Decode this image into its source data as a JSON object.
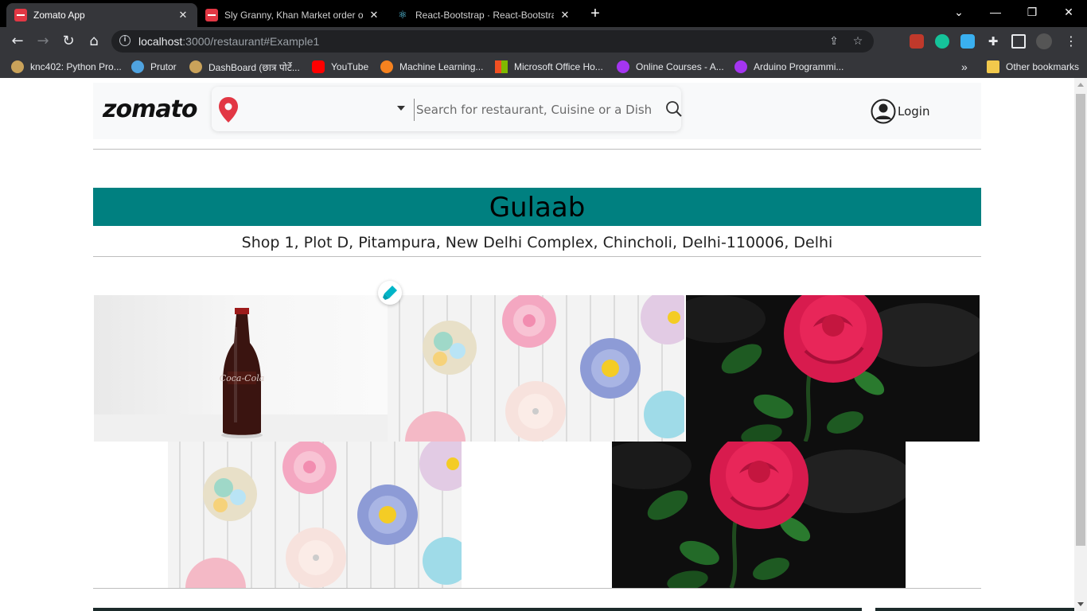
{
  "browser": {
    "tabs": [
      {
        "title": "Zomato App",
        "active": true,
        "favicon": "zomato-icon"
      },
      {
        "title": "Sly Granny, Khan Market order o",
        "active": false,
        "favicon": "zomato-icon"
      },
      {
        "title": "React-Bootstrap · React-Bootstrap",
        "active": false,
        "favicon": "react-icon"
      }
    ],
    "new_tab": "+",
    "window_controls": {
      "chevron": "⌄",
      "minimize": "—",
      "restore": "❐",
      "close": "✕"
    },
    "url_host": "localhost",
    "url_rest": ":3000/restaurant#Example1",
    "bookmarks": [
      {
        "label": "knc402: Python Pro...",
        "color": "#c9a25a"
      },
      {
        "label": "Prutor",
        "color": "#4fa3e0"
      },
      {
        "label": "DashBoard (छात्र पोर्टे...",
        "color": "#c9a25a"
      },
      {
        "label": "YouTube",
        "color": "#ff0000"
      },
      {
        "label": "Machine Learning...",
        "color": "#f5821f"
      },
      {
        "label": "Microsoft Office Ho...",
        "color": "#f25022"
      },
      {
        "label": "Online Courses - A...",
        "color": "#a435f0"
      },
      {
        "label": "Arduino Programmi...",
        "color": "#a435f0"
      }
    ],
    "bookmarks_overflow": "»",
    "other_bookmarks": "Other bookmarks"
  },
  "header": {
    "logo": "zomato",
    "search_placeholder": "Search for restaurant, Cuisine or a Dish",
    "login_label": "Login"
  },
  "restaurant": {
    "name": "Gulaab",
    "address": "Shop 1, Plot D, Pitampura, New Delhi Complex, Chincholi, Delhi-110006, Delhi",
    "band_color": "#008080"
  },
  "gallery": [
    {
      "name": "coca-cola-bottle-photo"
    },
    {
      "name": "cupcakes-photo"
    },
    {
      "name": "red-rose-photo"
    },
    {
      "name": "cupcakes-photo"
    },
    {
      "name": "red-rose-photo"
    }
  ],
  "colors": {
    "accent": "#e23744",
    "teal": "#008080"
  }
}
